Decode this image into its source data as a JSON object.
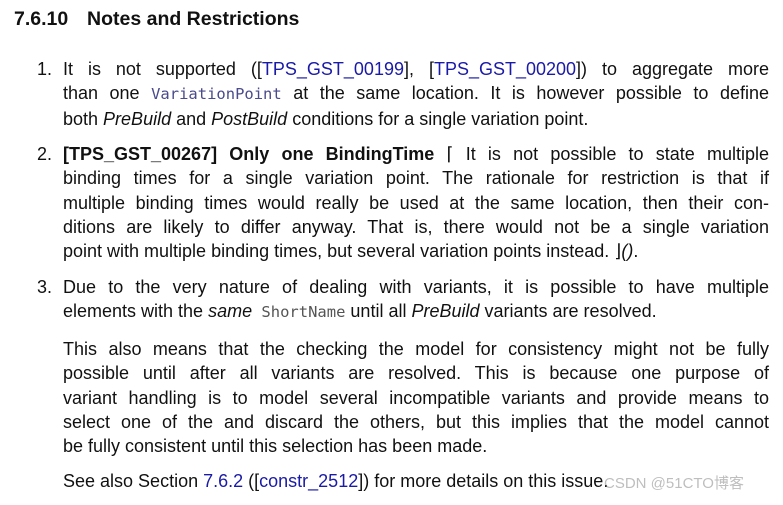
{
  "section": {
    "number": "7.6.10",
    "title": "Notes and Restrictions"
  },
  "items": [
    {
      "marker": "1.",
      "lines": [
        {
          "a": "It is not supported ([",
          "ref1": "TPS_GST_00199",
          "b": "], [",
          "ref2": "TPS_GST_00200",
          "c": "]) to aggregate more"
        },
        {
          "a": "than one ",
          "code": "VariationPoint",
          "b": " at the same location. It is however possible to define"
        },
        {
          "a": "both ",
          "em1": "PreBuild",
          "b": " and ",
          "em2": "PostBuild",
          "c": " conditions for a single variation point."
        }
      ]
    },
    {
      "marker": "2.",
      "lines": [
        {
          "bold": "[TPS_GST_00267] Only one BindingTime",
          "a": " ⌈ It is not possible to state multiple"
        },
        {
          "a": "binding times for a single variation point. The rationale for restriction is that if"
        },
        {
          "a": "multiple binding times would really be used at the same location, then their con-"
        },
        {
          "a": "ditions are likely to differ anyway. That is, there would not be a single variation"
        },
        {
          "a": "point with multiple binding times, but several variation points instead. ⌋",
          "em": "()",
          "b": "."
        }
      ]
    },
    {
      "marker": "3.",
      "lines": [
        {
          "a": "Due to the very nature of dealing with variants, it is possible to have multiple"
        },
        {
          "a": "elements with the ",
          "em": "same",
          "code": " ShortName",
          "b": " until all ",
          "em2": "PreBuild",
          "c": " variants are resolved."
        }
      ],
      "para2": [
        "This also means that the checking the model for consistency might not be fully",
        "possible until after all variants are resolved. This is because one purpose of",
        "variant handling is to model several incompatible variants and provide means to",
        "select one of the and discard the others, but this implies that the model cannot",
        "be fully consistent until this selection has been made."
      ],
      "para3": {
        "a": "See also Section ",
        "ref1": "7.6.2",
        "b": " ([",
        "ref2": "constr_2512",
        "c": "]) for more details on this issue."
      }
    }
  ],
  "watermark": "CSDN @51CTO博客"
}
